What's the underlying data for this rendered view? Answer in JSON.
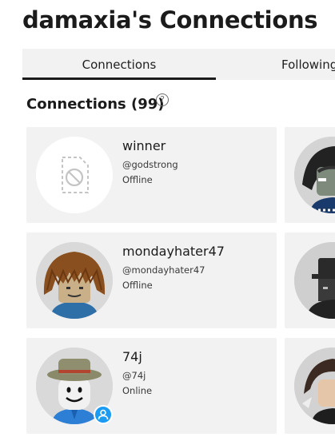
{
  "page": {
    "title": "damaxia's Connections"
  },
  "tabs": [
    {
      "label": "Connections",
      "active": true
    },
    {
      "label": "Following",
      "active": false
    }
  ],
  "section": {
    "heading": "Connections (99)",
    "help_icon": "help-circle-icon"
  },
  "connections": [
    {
      "name": "winner",
      "handle": "@godstrong",
      "status": "Offline",
      "avatar": "placeholder-image-icon"
    },
    {
      "name": "mondayhater47",
      "handle": "@mondayhater47",
      "status": "Offline",
      "avatar": "avatar-brown-hair"
    },
    {
      "name": "74j",
      "handle": "@74j",
      "status": "Online",
      "avatar": "avatar-safari-hat",
      "presence_icon": "online-user-icon"
    }
  ],
  "colors": {
    "card_bg": "#f2f2f2",
    "tab_underline": "#1b1b1b",
    "online_badge": "#1b9cf2"
  }
}
